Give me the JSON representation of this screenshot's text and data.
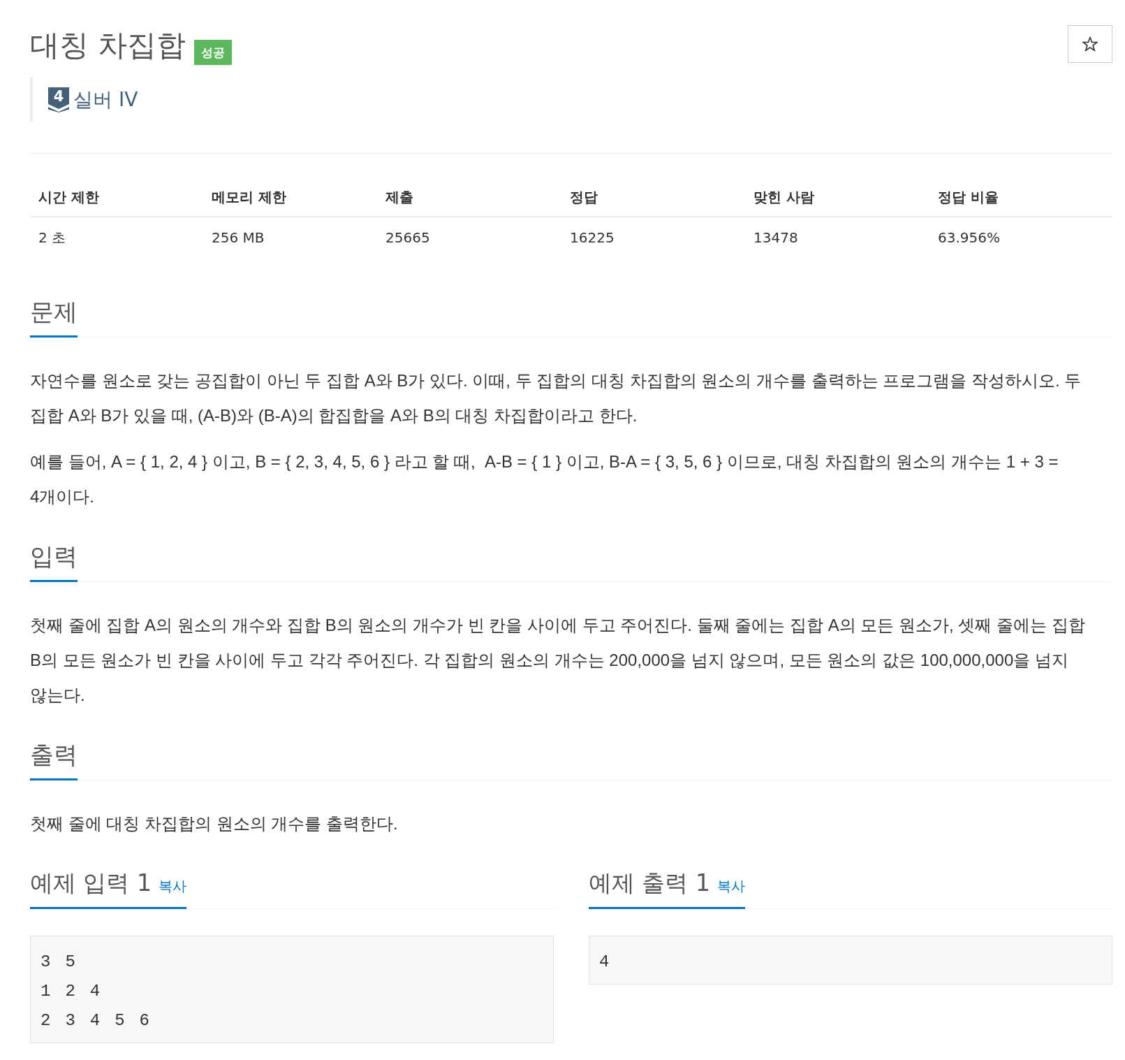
{
  "title": "대칭 차집합",
  "result_badge": {
    "label": "성공",
    "kind": "success"
  },
  "favorite": {
    "starred": false
  },
  "tier": {
    "number": "4",
    "label": "실버 IV",
    "kind": "silver"
  },
  "limits_table": {
    "columns": [
      "시간 제한",
      "메모리 제한",
      "제출",
      "정답",
      "맞힌 사람",
      "정답 비율"
    ],
    "rows": [
      [
        "2 초",
        "256 MB",
        "25665",
        "16225",
        "13478",
        "63.956%"
      ]
    ]
  },
  "sections": [
    {
      "title": "문제",
      "paragraphs": [
        "자연수를 원소로 갖는 공집합이 아닌 두 집합 A와 B가 있다. 이때, 두 집합의 대칭 차집합의 원소의 개수를 출력하는 프로그램을 작성하시오. 두 집합 A와 B가 있을 때, (A-B)와 (B-A)의 합집합을 A와 B의 대칭 차집합이라고 한다.",
        "예를 들어, A = { 1, 2, 4 } 이고, B = { 2, 3, 4, 5, 6 } 라고 할 때,  A-B = { 1 } 이고, B-A = { 3, 5, 6 } 이므로, 대칭 차집합의 원소의 개수는 1 + 3 = 4개이다."
      ]
    },
    {
      "title": "입력",
      "paragraphs": [
        "첫째 줄에 집합 A의 원소의 개수와 집합 B의 원소의 개수가 빈 칸을 사이에 두고 주어진다. 둘째 줄에는 집합 A의 모든 원소가, 셋째 줄에는 집합 B의 모든 원소가 빈 칸을 사이에 두고 각각 주어진다. 각 집합의 원소의 개수는 200,000을 넘지 않으며, 모든 원소의 값은 100,000,000을 넘지 않는다."
      ]
    },
    {
      "title": "출력",
      "paragraphs": [
        "첫째 줄에 대칭 차집합의 원소의 개수를 출력한다."
      ]
    }
  ],
  "samples": [
    {
      "title": "예제 입력 1",
      "copy_label": "복사",
      "content": "3 5\n1 2 4\n2 3 4 5 6"
    },
    {
      "title": "예제 출력 1",
      "copy_label": "복사",
      "content": "4"
    }
  ]
}
